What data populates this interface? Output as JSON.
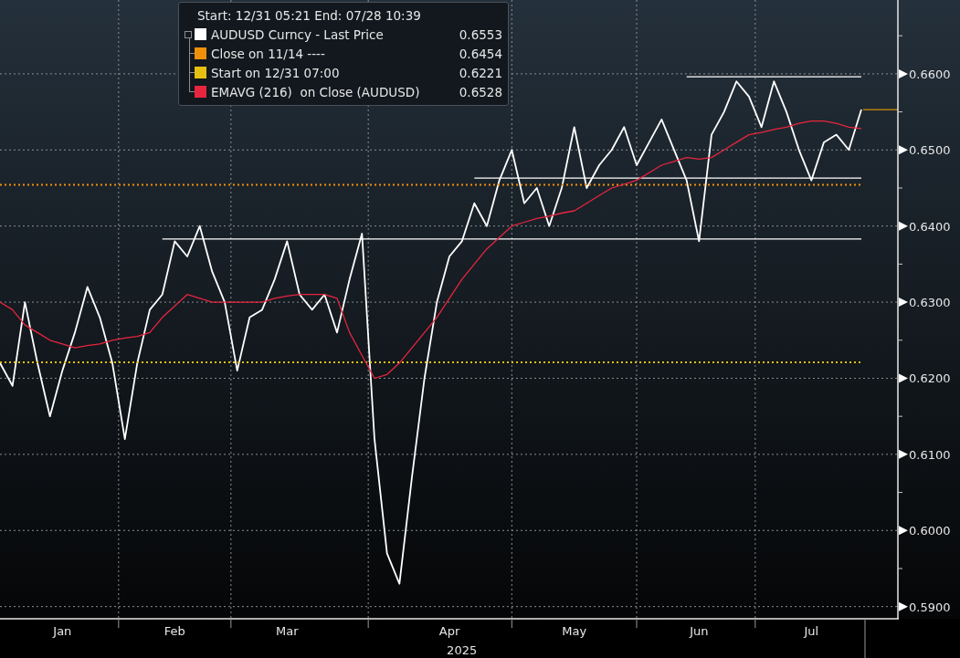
{
  "legend": {
    "header": "Start: 12/31 05:21 End: 07/28 10:39",
    "values": [
      "0.6553",
      "0.6454",
      "0.6221",
      "0.6528"
    ]
  },
  "chart_data": {
    "type": "line",
    "xlabel": "2025",
    "ylim": [
      0.5884,
      0.6697
    ],
    "grid": true,
    "series": [
      {
        "name": "AUDUSD Curncy - Last Price",
        "color": "#ffffff",
        "values": [
          0.622,
          0.619,
          0.63,
          0.622,
          0.615,
          0.621,
          0.626,
          0.632,
          0.628,
          0.622,
          0.612,
          0.622,
          0.629,
          0.631,
          0.638,
          0.636,
          0.64,
          0.634,
          0.63,
          0.621,
          0.628,
          0.629,
          0.633,
          0.638,
          0.631,
          0.629,
          0.631,
          0.626,
          0.633,
          0.639,
          0.612,
          0.597,
          0.593,
          0.607,
          0.62,
          0.63,
          0.636,
          0.638,
          0.643,
          0.64,
          0.646,
          0.65,
          0.643,
          0.645,
          0.64,
          0.645,
          0.653,
          0.645,
          0.648,
          0.65,
          0.653,
          0.648,
          0.651,
          0.654,
          0.65,
          0.646,
          0.638,
          0.652,
          0.655,
          0.659,
          0.657,
          0.653,
          0.659,
          0.655,
          0.65,
          0.646,
          0.651,
          0.652,
          0.65,
          0.6553
        ]
      },
      {
        "color": "#ffffff",
        "values": [
          null,
          null,
          null,
          null,
          null,
          null,
          null,
          null,
          null,
          null,
          null,
          null,
          null,
          null,
          null,
          null,
          null,
          null,
          null,
          null,
          null,
          null,
          null,
          null,
          null,
          null,
          null,
          null,
          null,
          null,
          null,
          null,
          null,
          null,
          null,
          null,
          null,
          null,
          null,
          null,
          null,
          null,
          null,
          null,
          null,
          null,
          null,
          null,
          null,
          null,
          null,
          null,
          null,
          null,
          null,
          0.6596,
          0.6596,
          0.6596,
          0.6596,
          0.6596,
          0.6596,
          0.6596,
          0.6596,
          0.6596,
          0.6596,
          0.6596,
          0.6596,
          0.6596,
          0.6596,
          0.6596
        ]
      },
      {
        "color": "#ffffff",
        "values": [
          null,
          null,
          null,
          null,
          null,
          null,
          null,
          null,
          null,
          null,
          null,
          null,
          null,
          null,
          null,
          null,
          null,
          null,
          null,
          null,
          null,
          null,
          null,
          null,
          null,
          null,
          null,
          null,
          null,
          null,
          null,
          null,
          null,
          null,
          null,
          null,
          null,
          null,
          0.6463,
          0.6463,
          0.6463,
          0.6463,
          0.6463,
          0.6463,
          0.6463,
          0.6463,
          0.6463,
          0.6463,
          0.6463,
          0.6463,
          0.6463,
          0.6463,
          0.6463,
          0.6463,
          0.6463,
          0.6463,
          0.6463,
          0.6463,
          0.6463,
          0.6463,
          0.6463,
          0.6463,
          0.6463,
          0.6463,
          0.6463,
          0.6463,
          0.6463,
          0.6463,
          0.6463,
          0.6463
        ]
      },
      {
        "color": "#ffffff",
        "values": [
          null,
          null,
          null,
          null,
          null,
          null,
          null,
          null,
          null,
          null,
          null,
          null,
          null,
          0.6383,
          0.6383,
          0.6383,
          0.6383,
          0.6383,
          0.6383,
          0.6383,
          0.6383,
          0.6383,
          0.6383,
          0.6383,
          0.6383,
          0.6383,
          0.6383,
          0.6383,
          0.6383,
          0.6383,
          0.6383,
          0.6383,
          0.6383,
          0.6383,
          0.6383,
          0.6383,
          0.6383,
          0.6383,
          0.6383,
          0.6383,
          0.6383,
          0.6383,
          0.6383,
          0.6383,
          0.6383,
          0.6383,
          0.6383,
          0.6383,
          0.6383,
          0.6383,
          0.6383,
          0.6383,
          0.6383,
          0.6383,
          0.6383,
          0.6383,
          0.6383,
          0.6383,
          0.6383,
          0.6383,
          0.6383,
          0.6383,
          0.6383,
          0.6383,
          0.6383,
          0.6383,
          0.6383,
          0.6383,
          0.6383,
          0.6383
        ]
      },
      {
        "name": "Close on 11/14 ----",
        "color": "#f0900a",
        "line_style": "dotted",
        "values": [
          0.6454,
          0.6454,
          0.6454,
          0.6454,
          0.6454,
          0.6454,
          0.6454,
          0.6454,
          0.6454,
          0.6454,
          0.6454,
          0.6454,
          0.6454,
          0.6454,
          0.6454,
          0.6454,
          0.6454,
          0.6454,
          0.6454,
          0.6454,
          0.6454,
          0.6454,
          0.6454,
          0.6454,
          0.6454,
          0.6454,
          0.6454,
          0.6454,
          0.6454,
          0.6454,
          0.6454,
          0.6454,
          0.6454,
          0.6454,
          0.6454,
          0.6454,
          0.6454,
          0.6454,
          0.6454,
          0.6454,
          0.6454,
          0.6454,
          0.6454,
          0.6454,
          0.6454,
          0.6454,
          0.6454,
          0.6454,
          0.6454,
          0.6454,
          0.6454,
          0.6454,
          0.6454,
          0.6454,
          0.6454,
          0.6454,
          0.6454,
          0.6454,
          0.6454,
          0.6454,
          0.6454,
          0.6454,
          0.6454,
          0.6454,
          0.6454,
          0.6454,
          0.6454,
          0.6454,
          0.6454,
          0.6454
        ]
      },
      {
        "name": "Start on 12/31 07:00",
        "color": "#e5c010",
        "line_style": "dotted",
        "values": [
          0.6221,
          0.6221,
          0.6221,
          0.6221,
          0.6221,
          0.6221,
          0.6221,
          0.6221,
          0.6221,
          0.6221,
          0.6221,
          0.6221,
          0.6221,
          0.6221,
          0.6221,
          0.6221,
          0.6221,
          0.6221,
          0.6221,
          0.6221,
          0.6221,
          0.6221,
          0.6221,
          0.6221,
          0.6221,
          0.6221,
          0.6221,
          0.6221,
          0.6221,
          0.6221,
          0.6221,
          0.6221,
          0.6221,
          0.6221,
          0.6221,
          0.6221,
          0.6221,
          0.6221,
          0.6221,
          0.6221,
          0.6221,
          0.6221,
          0.6221,
          0.6221,
          0.6221,
          0.6221,
          0.6221,
          0.6221,
          0.6221,
          0.6221,
          0.6221,
          0.6221,
          0.6221,
          0.6221,
          0.6221,
          0.6221,
          0.6221,
          0.6221,
          0.6221,
          0.6221,
          0.6221,
          0.6221,
          0.6221,
          0.6221,
          0.6221,
          0.6221,
          0.6221,
          0.6221,
          0.6221,
          0.6221
        ]
      },
      {
        "name": "EMAVG (216)  on Close (AUDUSD)",
        "color": "#e8253f",
        "values": [
          0.63,
          0.629,
          0.627,
          0.626,
          0.625,
          0.6245,
          0.624,
          0.6243,
          0.6245,
          0.625,
          0.6253,
          0.6255,
          0.626,
          0.628,
          0.6295,
          0.631,
          0.6305,
          0.63,
          0.63,
          0.63,
          0.63,
          0.63,
          0.6305,
          0.6308,
          0.631,
          0.631,
          0.631,
          0.6305,
          0.626,
          0.623,
          0.62,
          0.6205,
          0.622,
          0.624,
          0.626,
          0.628,
          0.6305,
          0.633,
          0.635,
          0.637,
          0.6385,
          0.64,
          0.6405,
          0.641,
          0.6413,
          0.6417,
          0.642,
          0.643,
          0.644,
          0.645,
          0.6455,
          0.646,
          0.647,
          0.648,
          0.6485,
          0.649,
          0.6488,
          0.649,
          0.65,
          0.651,
          0.652,
          0.6523,
          0.6527,
          0.653,
          0.6535,
          0.6538,
          0.6538,
          0.6535,
          0.653,
          0.6528
        ]
      }
    ],
    "categories": [
      null,
      null,
      null,
      null,
      null,
      "Jan",
      null,
      null,
      null,
      null,
      null,
      null,
      null,
      null,
      "Feb",
      null,
      null,
      null,
      null,
      null,
      null,
      null,
      null,
      "Mar",
      null,
      null,
      null,
      null,
      null,
      null,
      null,
      null,
      null,
      null,
      null,
      null,
      "Apr",
      null,
      null,
      null,
      null,
      null,
      null,
      null,
      null,
      null,
      "May",
      null,
      null,
      null,
      null,
      null,
      null,
      null,
      null,
      null,
      "Jun",
      null,
      null,
      null,
      null,
      null,
      null,
      null,
      null,
      "Jul",
      null,
      null,
      null,
      null
    ],
    "yticks": [
      {
        "value": 0.59,
        "label": "0.5900"
      },
      {
        "value": 0.6,
        "label": "0.6000"
      },
      {
        "value": 0.61,
        "label": "0.6100"
      },
      {
        "value": 0.62,
        "label": "0.6200"
      },
      {
        "value": 0.63,
        "label": "0.6300"
      },
      {
        "value": 0.64,
        "label": "0.6400"
      },
      {
        "value": 0.65,
        "label": "0.6500"
      },
      {
        "value": 0.66,
        "label": "0.6600"
      }
    ]
  }
}
